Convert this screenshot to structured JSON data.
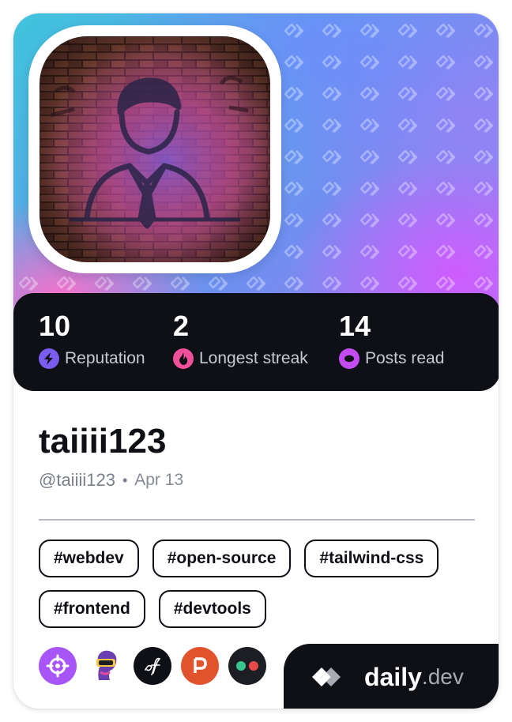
{
  "profile": {
    "display_name": "taiiii123",
    "handle": "@taiiii123",
    "separator": "•",
    "joined": "Apr 13"
  },
  "stats": [
    {
      "value": "10",
      "label": "Reputation",
      "icon": "lightning-icon",
      "color": "#7b5cf0"
    },
    {
      "value": "2",
      "label": "Longest streak",
      "icon": "flame-icon",
      "color": "#f0509a"
    },
    {
      "value": "14",
      "label": "Posts read",
      "icon": "eye-icon",
      "color": "#c24cf2"
    }
  ],
  "tags": [
    "#webdev",
    "#open-source",
    "#tailwind-css",
    "#frontend",
    "#devtools"
  ],
  "squads": [
    {
      "icon": "crosshair-icon",
      "color": "#a855f7"
    },
    {
      "icon": "vr-headset-icon",
      "color": "#ffffff"
    },
    {
      "icon": "af-logo-icon",
      "color": "#0e1016"
    },
    {
      "icon": "product-hunt-icon",
      "color": "#e0532d"
    },
    {
      "icon": "dots-icon",
      "color": "#1c1e24"
    }
  ],
  "brand": {
    "name": "daily",
    "tld": ".dev"
  },
  "colors": {
    "card_dark": "#0e1016",
    "text_muted": "#7b7f8c"
  }
}
